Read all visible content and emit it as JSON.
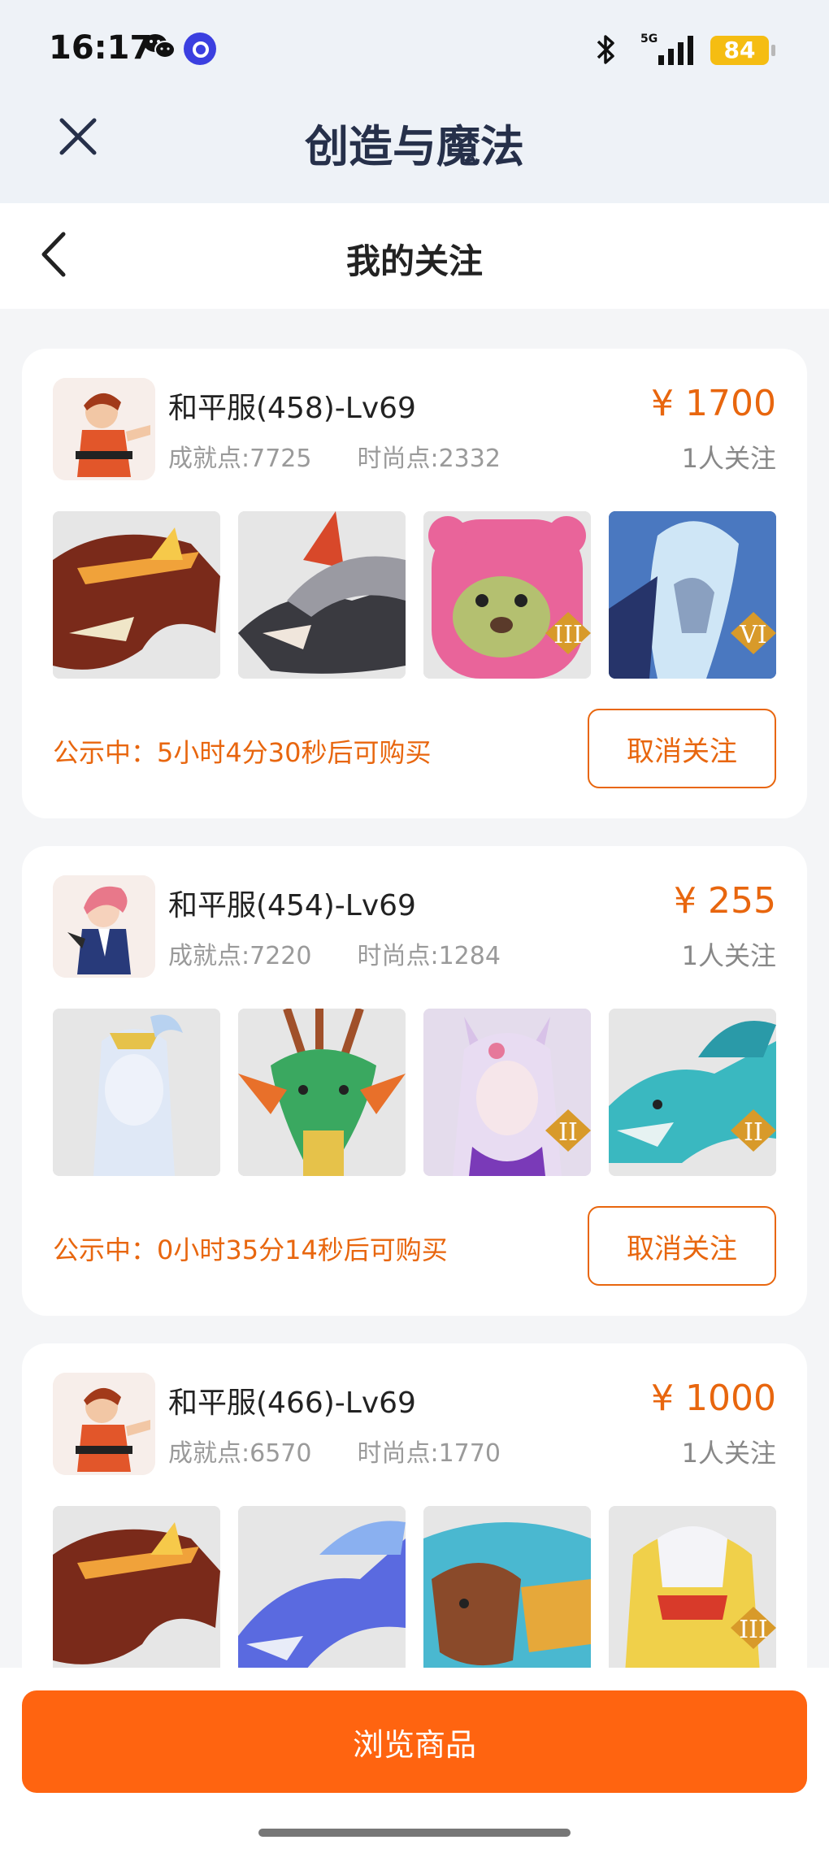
{
  "status": {
    "time": "16:17",
    "battery": "84"
  },
  "app": {
    "title": "创造与魔法"
  },
  "nav": {
    "title": "我的关注"
  },
  "items": [
    {
      "server": "和平服(458)-Lv69",
      "achievement": "成就点:7725",
      "fashion": "时尚点:2332",
      "price": "¥ 1700",
      "followers": "1人关注",
      "notice": "公示中：5小时4分30秒后可购买",
      "unfollow": "取消关注",
      "badges": [
        "",
        "",
        "III",
        "VI"
      ]
    },
    {
      "server": "和平服(454)-Lv69",
      "achievement": "成就点:7220",
      "fashion": "时尚点:1284",
      "price": "¥ 255",
      "followers": "1人关注",
      "notice": "公示中：0小时35分14秒后可购买",
      "unfollow": "取消关注",
      "badges": [
        "",
        "",
        "II",
        "II"
      ]
    },
    {
      "server": "和平服(466)-Lv69",
      "achievement": "成就点:6570",
      "fashion": "时尚点:1770",
      "price": "¥ 1000",
      "followers": "1人关注",
      "notice": "",
      "unfollow": "",
      "badges": [
        "",
        "",
        "",
        "III"
      ]
    }
  ],
  "footer": {
    "browse": "浏览商品"
  },
  "colors": {
    "accent": "#ff6410",
    "price": "#e8660e"
  }
}
